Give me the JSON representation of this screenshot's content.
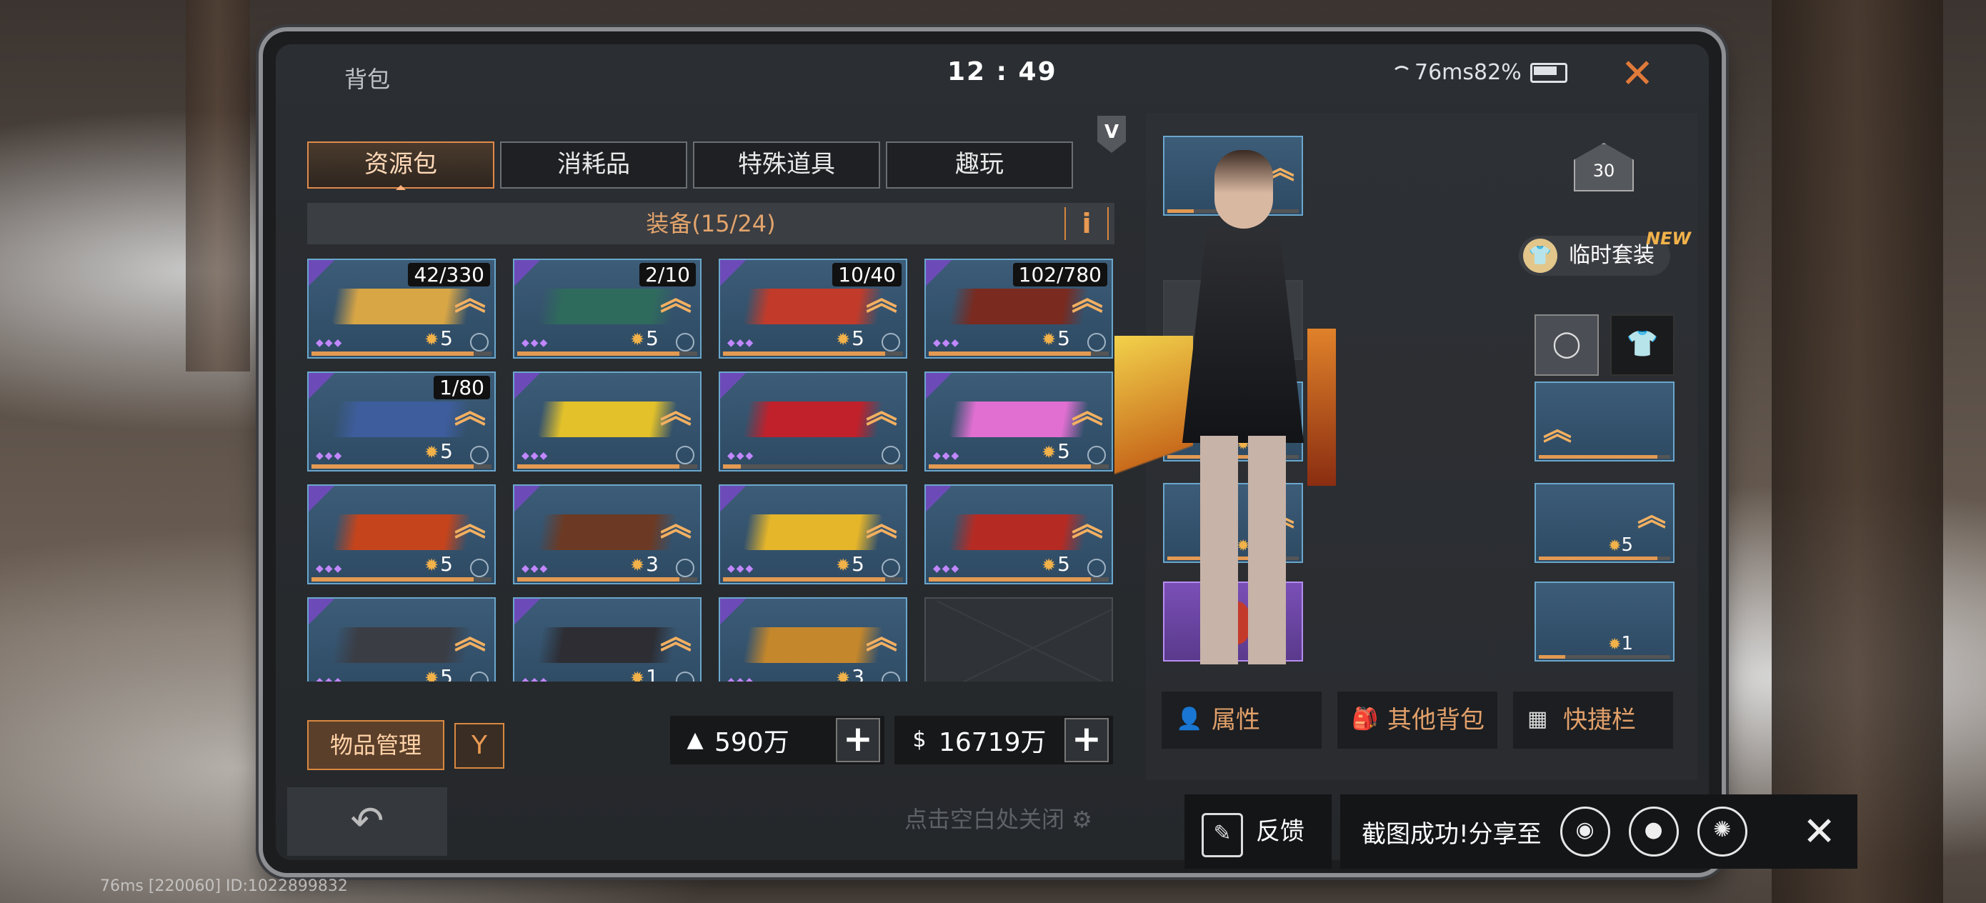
{
  "status_bar": {
    "title": "背包",
    "time": "12 : 49",
    "network": "76ms82%"
  },
  "tabs": [
    {
      "label": "资源包",
      "active": true
    },
    {
      "label": "消耗品",
      "active": false
    },
    {
      "label": "特殊道具",
      "active": false
    },
    {
      "label": "趣玩",
      "active": false
    }
  ],
  "equip": {
    "header": "装备(15/24)",
    "info": "i"
  },
  "vip_badge": "V",
  "grid": [
    {
      "count": "42/330",
      "stars": "5",
      "progress": 0.9,
      "color": "#d9a645"
    },
    {
      "count": "2/10",
      "stars": "5",
      "progress": 0.9,
      "color": "#2f6b5c"
    },
    {
      "count": "10/40",
      "stars": "5",
      "progress": 0.9,
      "color": "#c23b2a"
    },
    {
      "count": "102/780",
      "stars": "5",
      "progress": 0.9,
      "color": "#7a2a1f"
    },
    {
      "count": "1/80",
      "stars": "5",
      "progress": 0.9,
      "color": "#3e5d9c"
    },
    {
      "count": "",
      "stars": "",
      "progress": 0.9,
      "color": "#e2c12a"
    },
    {
      "count": "",
      "stars": "",
      "progress": 0.1,
      "color": "#c0212b"
    },
    {
      "count": "",
      "stars": "5",
      "progress": 0.9,
      "color": "#e06fd1"
    },
    {
      "count": "",
      "stars": "5",
      "progress": 0.9,
      "color": "#c5441c"
    },
    {
      "count": "",
      "stars": "3",
      "progress": 0.9,
      "color": "#6c3a24"
    },
    {
      "count": "",
      "stars": "5",
      "progress": 0.9,
      "color": "#e5b52a"
    },
    {
      "count": "",
      "stars": "5",
      "progress": 0.9,
      "color": "#b52b24"
    },
    {
      "count": "",
      "stars": "5",
      "progress": 0.9,
      "color": "#3b3d44"
    },
    {
      "count": "",
      "stars": "1",
      "progress": 0.9,
      "color": "#2d2d33"
    },
    {
      "count": "",
      "stars": "3",
      "progress": 0.9,
      "color": "#c5872b"
    },
    {
      "count": "",
      "stars": "",
      "progress": 0,
      "color": "",
      "empty": true
    }
  ],
  "bottom": {
    "manage": "物品管理",
    "filter": "Y",
    "currency1": "590万",
    "currency2": "16719万",
    "hint": "点击空白处关闭"
  },
  "right": {
    "slots": [
      {
        "stars": "3"
      },
      {
        "stars": "5"
      },
      {
        "stars": "5"
      },
      {
        "stars": "5"
      },
      {
        "stars": "1"
      }
    ],
    "level": "30",
    "temp_suit": "临时套装",
    "new_tag": "NEW",
    "buttons": [
      "属性",
      "其他背包",
      "快捷栏"
    ]
  },
  "share": {
    "feedback": "反馈",
    "text": "截图成功!分享至"
  },
  "footer": "76ms  [220060] ID:1022899832"
}
